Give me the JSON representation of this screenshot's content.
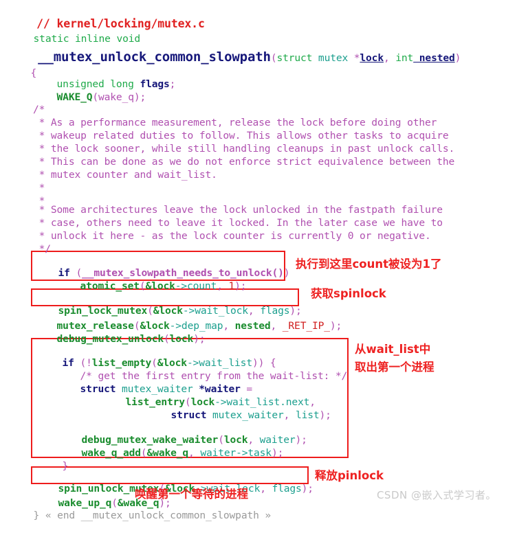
{
  "document": {
    "title": "// kernel/locking/mutex.c",
    "language": "c",
    "source_file": "kernel/locking/mutex.c",
    "function": "__mutex_unlock_common_slowpath"
  },
  "colors": {
    "comment": "#b050b0",
    "keyword": "#1faa4a",
    "keyword_blue": "#16177a",
    "type": "#1c9f8e",
    "function": "#1a8c2e",
    "macro": "#d02020",
    "number": "#d02020",
    "annotation_red": "#ee2222",
    "box_border": "#ee1c1c",
    "watermark": "#c9c9c9",
    "background": "#ffffff"
  },
  "code": {
    "title_line": "// kernel/locking/mutex.c",
    "signature_prefix": "static inline void",
    "signature_name": "__mutex_unlock_common_slowpath",
    "signature_params": "(struct mutex *lock, int nested)",
    "open_brace": "{",
    "decl_1_type": "unsigned long ",
    "decl_1_name": "flags",
    "decl_1_end": ";",
    "decl_2_macro": "WAKE_Q",
    "decl_2_arg": "(wake_q);",
    "comment_block_1": [
      "/*",
      " * As a performance measurement, release the lock before doing other",
      " * wakeup related duties to follow. This allows other tasks to acquire",
      " * the lock sooner, while still handling cleanups in past unlock calls.",
      " * This can be done as we do not enforce strict equivalence between the",
      " * mutex counter and wait_list.",
      " *",
      " *",
      " * Some architectures leave the lock unlocked in the fastpath failure",
      " * case, others need to leave it locked. In the later case we have to",
      " * unlock it here - as the lock counter is currently 0 or negative.",
      " */"
    ],
    "if_needs_unlock": {
      "kw": "if",
      "open": " (",
      "call": "__mutex_slowpath_needs_to_unlock()",
      "close": ")"
    },
    "atomic_set": {
      "fn": "atomic_set",
      "open": "(",
      "amp": "&lock",
      "field": "->count",
      "sep": ", ",
      "num": "1",
      "close": ");"
    },
    "spin_lock_mutex": {
      "fn": "spin_lock_mutex",
      "open": "(",
      "amp": "&lock",
      "field": "->wait_lock",
      "sep": ", ",
      "arg": "flags",
      "close": ");"
    },
    "mutex_release": {
      "fn": "mutex_release",
      "open": "(",
      "amp": "&lock",
      "field": "->dep_map",
      "sep1": ", ",
      "arg1": "nested",
      "sep2": ", ",
      "arg2": "_RET_IP_",
      "close": ");"
    },
    "debug_mutex_unlock": {
      "fn": "debug_mutex_unlock",
      "open": "(",
      "arg": "lock",
      "close": ");"
    },
    "if_list_empty": {
      "kw": "if",
      "open": " (!",
      "fn": "list_empty",
      "p1": "(",
      "amp": "&lock",
      "field": "->wait_list",
      "close": ")) {"
    },
    "inner_comment": "/* get the first entry from the wait-list: */",
    "waiter_decl": {
      "kw": "struct",
      "type": " mutex_waiter ",
      "name": "*waiter",
      "eq": " ="
    },
    "list_entry": {
      "fn": "list_entry",
      "open": "(",
      "arg": "lock",
      "field": "->wait_list.next",
      "close": ","
    },
    "list_entry_2": {
      "kw": "struct",
      "type": " mutex_waiter",
      "sep": ", ",
      "arg": "list",
      "close": ");"
    },
    "debug_mutex_wake_waiter": {
      "fn": "debug_mutex_wake_waiter",
      "open": "(",
      "arg1": "lock",
      "sep": ", ",
      "arg2": "waiter",
      "close": ");"
    },
    "wake_q_add": {
      "fn": "wake_q_add",
      "open": "(",
      "arg1": "&wake_q",
      "sep": ", ",
      "arg2": "waiter->task",
      "close": ");"
    },
    "close_brace_inner": "}",
    "spin_unlock_mutex": {
      "fn": "spin_unlock_mutex",
      "open": "(",
      "amp": "&lock",
      "field": "->wait_lock",
      "sep": ", ",
      "arg": "flags",
      "close": ");"
    },
    "wake_up_q": {
      "fn": "wake_up_q",
      "open": "(",
      "arg": "&wake_q",
      "close": ");"
    },
    "end_marker": "} « end __mutex_unlock_common_slowpath »"
  },
  "annotations": [
    {
      "id": "annot-count-set",
      "text": "执行到这里count被设为1了",
      "target": "if (__mutex_slowpath_needs_to_unlock()) / atomic_set(&lock->count, 1);"
    },
    {
      "id": "annot-acquire-spinlock",
      "text": "获取spinlock",
      "target": "spin_lock_mutex(&lock->wait_lock, flags);"
    },
    {
      "id": "annot-waitlist-line1",
      "text": "从wait_list中",
      "target": "if (!list_empty(&lock->wait_list)) { ... }"
    },
    {
      "id": "annot-waitlist-line2",
      "text": "取出第一个进程",
      "target": "if (!list_empty(&lock->wait_list)) { ... }"
    },
    {
      "id": "annot-release-spinlock",
      "text": "释放pinlock",
      "target": "spin_unlock_mutex(&lock->wait_lock, flags);"
    },
    {
      "id": "annot-wakeup",
      "text": "唤醒第一个等待的进程",
      "target": "wake_up_q(&wake_q);"
    }
  ],
  "watermark": {
    "text": "CSDN @嵌入式学习者。"
  }
}
